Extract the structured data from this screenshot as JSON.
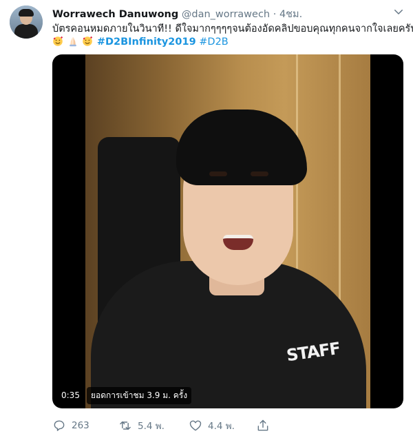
{
  "tweet": {
    "author_name": "Worrawech Danuwong",
    "handle": "@dan_worrawech",
    "separator": "·",
    "time": "4ชม.",
    "text_line1": "บัตรคอนหมดภายในวินาที!! ดีใจมากๆๆๆๆจนต้องอัดคลิปขอบคุณทุกคนจากใจเลยครับ",
    "hashtag_primary": "#D2BInfinity2019",
    "hashtag_secondary": "#D2B",
    "emojis": [
      "smiling-face-with-hearts-emoji",
      "folded-hands-emoji",
      "smiling-face-with-hearts-emoji"
    ]
  },
  "video": {
    "duration": "0:35",
    "views_text": "ยอดการเข้าชม 3.9 ม. ครั้ง",
    "shirt_text": "STAFF"
  },
  "actions": {
    "replies": "263",
    "retweets": "5.4 พ.",
    "likes": "4.4 พ."
  },
  "icons": {
    "menu": "chevron-down-icon",
    "reply": "reply-icon",
    "retweet": "retweet-icon",
    "like": "heart-icon",
    "share": "share-icon"
  },
  "colors": {
    "link": "#1b95e0",
    "muted": "#657786",
    "text": "#14171a"
  }
}
